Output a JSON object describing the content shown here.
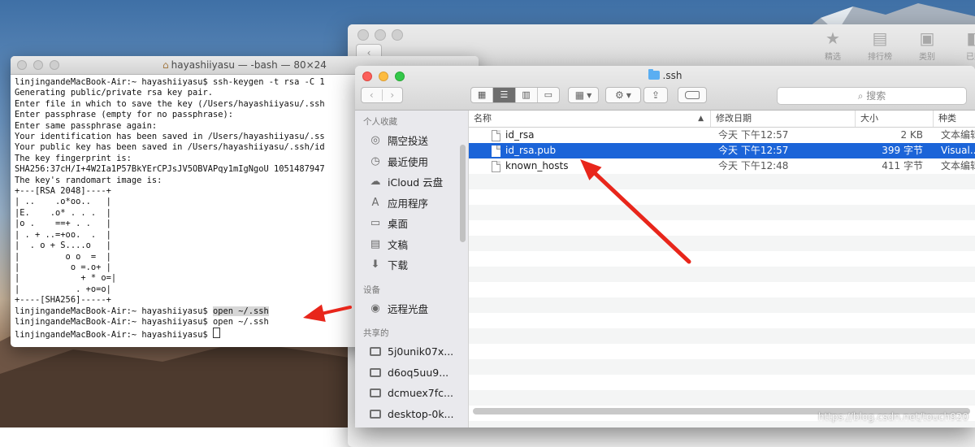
{
  "store": {
    "tools": [
      {
        "label": "精选",
        "icon": "star-icon"
      },
      {
        "label": "排行榜",
        "icon": "list-icon"
      },
      {
        "label": "类别",
        "icon": "categories-icon"
      },
      {
        "label": "已购",
        "icon": "purchased-icon"
      }
    ]
  },
  "terminal": {
    "title": "hayashiiyasu — -bash — 80×24",
    "lines": [
      "linjingandeMacBook-Air:~ hayashiiyasu$ ssh-keygen -t rsa -C 1",
      "Generating public/private rsa key pair.",
      "Enter file in which to save the key (/Users/hayashiiyasu/.ssh",
      "Enter passphrase (empty for no passphrase):",
      "Enter same passphrase again:",
      "Your identification has been saved in /Users/hayashiiyasu/.ss",
      "Your public key has been saved in /Users/hayashiiyasu/.ssh/id",
      "The key fingerprint is:",
      "SHA256:37cH/I+4W2Ia1P57BkYErCPJsJV5OBVAPqy1mIgNgoU 1051487947",
      "The key's randomart image is:",
      "+---[RSA 2048]----+",
      "| ..    .o*oo..   |",
      "|E.    .o* . . .  |",
      "|o .    ==+ . .   |",
      "| . + ..=+oo.  .  |",
      "|  . o + S....o   |",
      "|         o o  =  |",
      "|          o =.o+ |",
      "|            + * o=|",
      "|           . +o=o|",
      "+----[SHA256]-----+"
    ],
    "prompt": "linjingandeMacBook-Air:~ hayashiiyasu$ ",
    "cmd_highlight": "open ~/.ssh",
    "cmd_plain": "open ~/.ssh"
  },
  "finder": {
    "title": ".ssh",
    "search_placeholder": "搜索",
    "sidebar": {
      "favorites_title": "个人收藏",
      "favorites": [
        {
          "label": "隔空投送",
          "icon": "airdrop-icon"
        },
        {
          "label": "最近使用",
          "icon": "recents-icon"
        },
        {
          "label": "iCloud 云盘",
          "icon": "icloud-icon"
        },
        {
          "label": "应用程序",
          "icon": "applications-icon"
        },
        {
          "label": "桌面",
          "icon": "desktop-icon"
        },
        {
          "label": "文稿",
          "icon": "documents-icon"
        },
        {
          "label": "下载",
          "icon": "downloads-icon"
        }
      ],
      "devices_title": "设备",
      "devices": [
        {
          "label": "远程光盘",
          "icon": "remote-disc-icon"
        }
      ],
      "shared_title": "共享的",
      "shared": [
        {
          "label": "5j0unik07x...",
          "icon": "computer-icon"
        },
        {
          "label": "d6oq5uu9...",
          "icon": "computer-icon"
        },
        {
          "label": "dcmuex7fc...",
          "icon": "computer-icon"
        },
        {
          "label": "desktop-0k...",
          "icon": "computer-icon"
        }
      ]
    },
    "columns": {
      "name": "名称",
      "date": "修改日期",
      "size": "大小",
      "kind": "种类"
    },
    "files": [
      {
        "name": "id_rsa",
        "date": "今天 下午12:57",
        "size": "2 KB",
        "kind": "文本编辑",
        "selected": false
      },
      {
        "name": "id_rsa.pub",
        "date": "今天 下午12:57",
        "size": "399 字节",
        "kind": "Visual...",
        "selected": true
      },
      {
        "name": "known_hosts",
        "date": "今天 下午12:48",
        "size": "411 字节",
        "kind": "文本编辑",
        "selected": false
      }
    ]
  },
  "watermark": "https://blog.csdn.net/touch920",
  "colors": {
    "annotation": "#e8261b",
    "selection": "#1b64d8"
  }
}
